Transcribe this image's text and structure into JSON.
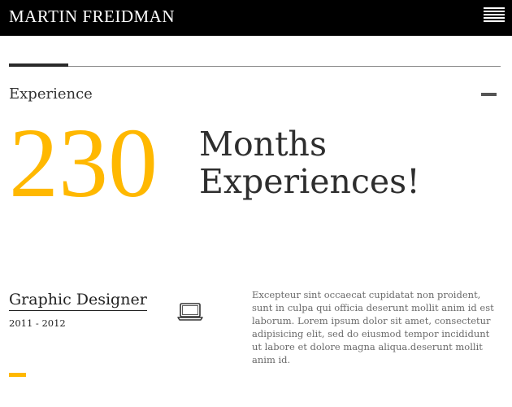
{
  "header": {
    "brand": "MARTIN FREIDMAN",
    "menu_icon": "hamburger-menu-icon"
  },
  "section": {
    "title": "Experience",
    "collapse_icon": "minus-icon"
  },
  "stat": {
    "value": "230",
    "label_line1": "Months",
    "label_line2": "Experiences!"
  },
  "job": {
    "title": "Graphic Designer",
    "years": "2011 - 2012",
    "icon": "laptop-icon",
    "description": "Excepteur sint occaecat cupidatat non proident, sunt in culpa qui officia deserunt mollit anim id est laborum. Lorem ipsum dolor sit amet, consectetur adipisicing elit, sed do eiusmod tempor incididunt ut labore et dolore magna aliqua.deserunt mollit anim id."
  },
  "colors": {
    "accent": "#ffb800",
    "header_bg": "#000000",
    "text": "#333333"
  }
}
